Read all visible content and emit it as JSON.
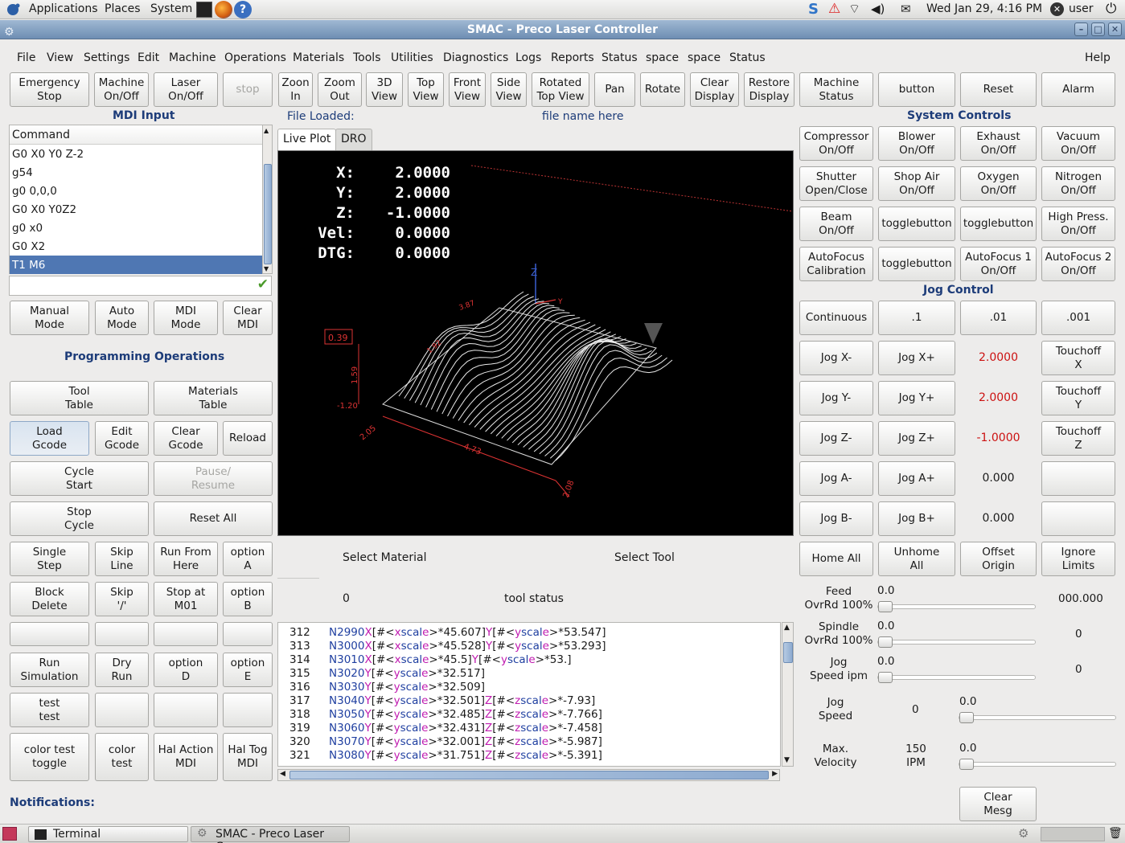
{
  "toppanel": {
    "applications": "Applications",
    "places": "Places",
    "system": "System",
    "datetime": "Wed Jan 29,  4:16 PM",
    "user": "user"
  },
  "window": {
    "title": "SMAC - Preco Laser Controller"
  },
  "menu": {
    "items": [
      "File",
      "View",
      "Settings",
      "Edit",
      "Machine",
      "Operations",
      "Materials",
      "Tools",
      "Utilities",
      "Diagnostics",
      "Logs",
      "Reports",
      "Status",
      "space",
      "space",
      "Status"
    ],
    "help": "Help"
  },
  "toolbar": [
    "Emergency\nStop",
    "Machine\nOn/Off",
    "Laser\nOn/Off",
    "stop",
    "Zoon\nIn",
    "Zoom\nOut",
    "3D\nView",
    "Top\nView",
    "Front\nView",
    "Side\nView",
    "Rotated\nTop View",
    "Pan",
    "Rotate",
    "Clear\nDisplay",
    "Restore\nDisplay",
    "Machine\nStatus",
    "button",
    "Reset",
    "Alarm"
  ],
  "mdi": {
    "title": "MDI Input",
    "column": "Command",
    "rows": [
      "G0 X0 Y0 Z-2",
      "g54",
      "g0 0,0,0",
      "G0 X0 Y0Z2",
      "g0 x0",
      "G0 X2",
      "T1 M6"
    ],
    "selected_index": 6,
    "modes": [
      "Manual\nMode",
      "Auto\nMode",
      "MDI\nMode",
      "Clear\nMDI"
    ]
  },
  "prog": {
    "title": "Programming Operations",
    "buttons": [
      "Tool\nTable",
      "Materials\nTable",
      "Load\nGcode",
      "Edit\nGcode",
      "Clear\nGcode",
      "Reload",
      "Cycle\nStart",
      "Pause/\nResume",
      "Stop\nCycle",
      "Reset All",
      "Single\nStep",
      "Skip\nLine",
      "Run From\nHere",
      "option\nA",
      "Block\nDelete",
      "Skip\n'/'",
      "Stop at\nM01",
      "option\nB",
      "",
      "",
      "",
      "",
      "Run\nSimulation",
      "Dry\nRun",
      "option\nD",
      "option\nE",
      "test\ntest",
      "",
      "",
      "",
      "color test\ntoggle",
      "color\ntest",
      "Hal Action\nMDI",
      "Hal Tog\nMDI"
    ]
  },
  "center": {
    "file_loaded_label": "File Loaded:",
    "file_name": "file name here",
    "tabs": [
      "Live Plot",
      "DRO"
    ],
    "select_material": "Select Material",
    "select_tool": "Select Tool",
    "tool_number": "0",
    "tool_status": "tool status"
  },
  "dro": {
    "labels": [
      "X:",
      "Y:",
      "Z:",
      "Vel:",
      "DTG:"
    ],
    "values": [
      "2.0000",
      "2.0000",
      "-1.0000",
      "0.0000",
      "0.0000"
    ]
  },
  "plot_labels": {
    "z_axis": "Z",
    "y_axis": "Y",
    "dims": [
      "0.39",
      "1.59",
      "-1.20",
      "2.05",
      "4.73",
      "2.08",
      "1.92",
      "3.87"
    ]
  },
  "gcode": [
    {
      "n": "312",
      "c": "N2990X[#<xscale>*45.607]Y[#<yscale>*53.547]"
    },
    {
      "n": "313",
      "c": "N3000X[#<xscale>*45.528]Y[#<yscale>*53.293]"
    },
    {
      "n": "314",
      "c": "N3010X[#<xscale>*45.5]Y[#<yscale>*53.]"
    },
    {
      "n": "315",
      "c": "N3020Y[#<yscale>*32.517]"
    },
    {
      "n": "316",
      "c": "N3030Y[#<yscale>*32.509]"
    },
    {
      "n": "317",
      "c": "N3040Y[#<yscale>*32.501]Z[#<zscale>*-7.93]"
    },
    {
      "n": "318",
      "c": "N3050Y[#<yscale>*32.485]Z[#<zscale>*-7.766]"
    },
    {
      "n": "319",
      "c": "N3060Y[#<yscale>*32.431]Z[#<zscale>*-7.458]"
    },
    {
      "n": "320",
      "c": "N3070Y[#<yscale>*32.001]Z[#<zscale>*-5.987]"
    },
    {
      "n": "321",
      "c": "N3080Y[#<yscale>*31.751]Z[#<zscale>*-5.391]"
    }
  ],
  "system_controls": {
    "title": "System Controls",
    "buttons": [
      "Compressor\nOn/Off",
      "Blower\nOn/Off",
      "Exhaust\nOn/Off",
      "Vacuum\nOn/Off",
      "Shutter\nOpen/Close",
      "Shop Air\nOn/Off",
      "Oxygen\nOn/Off",
      "Nitrogen\nOn/Off",
      "Beam\nOn/Off",
      "togglebutton",
      "togglebutton",
      "High Press.\nOn/Off",
      "AutoFocus\nCalibration",
      "togglebutton",
      "AutoFocus 1\nOn/Off",
      "AutoFocus 2\nOn/Off"
    ]
  },
  "jog": {
    "title": "Jog Control",
    "increments": [
      "Continuous",
      ".1",
      ".01",
      ".001"
    ],
    "rows": [
      {
        "minus": "Jog X-",
        "plus": "Jog X+",
        "value": "2.0000",
        "red": true,
        "touch": "Touchoff\nX"
      },
      {
        "minus": "Jog Y-",
        "plus": "Jog Y+",
        "value": "2.0000",
        "red": true,
        "touch": "Touchoff\nY"
      },
      {
        "minus": "Jog Z-",
        "plus": "Jog Z+",
        "value": "-1.0000",
        "red": true,
        "touch": "Touchoff\nZ"
      },
      {
        "minus": "Jog A-",
        "plus": "Jog A+",
        "value": "0.000",
        "red": false,
        "touch": ""
      },
      {
        "minus": "Jog B-",
        "plus": "Jog B+",
        "value": "0.000",
        "red": false,
        "touch": ""
      }
    ],
    "bottom": [
      "Home All",
      "Unhome\nAll",
      "Offset\nOrigin",
      "Ignore\nLimits"
    ]
  },
  "overrides": {
    "feed_label": "Feed\nOvrRd 100%",
    "feed_val": "0.0",
    "feed_right": "000.000",
    "spindle_label": "Spindle\nOvrRd 100%",
    "spindle_val": "0.0",
    "spindle_right": "0",
    "jogipm_label": "Jog\nSpeed ipm",
    "jogipm_val": "0.0",
    "jogipm_right": "0",
    "jogspeed_label": "Jog\nSpeed",
    "jogspeed_num": "0",
    "jogspeed_val": "0.0",
    "maxvel_label": "Max.\nVelocity",
    "maxvel_num": "150\nIPM",
    "maxvel_val": "0.0"
  },
  "notifications": {
    "label": "Notifications:",
    "clear": "Clear\nMesg"
  },
  "taskbar": {
    "terminal": "Terminal",
    "smac": "SMAC - Preco Laser Co..."
  }
}
